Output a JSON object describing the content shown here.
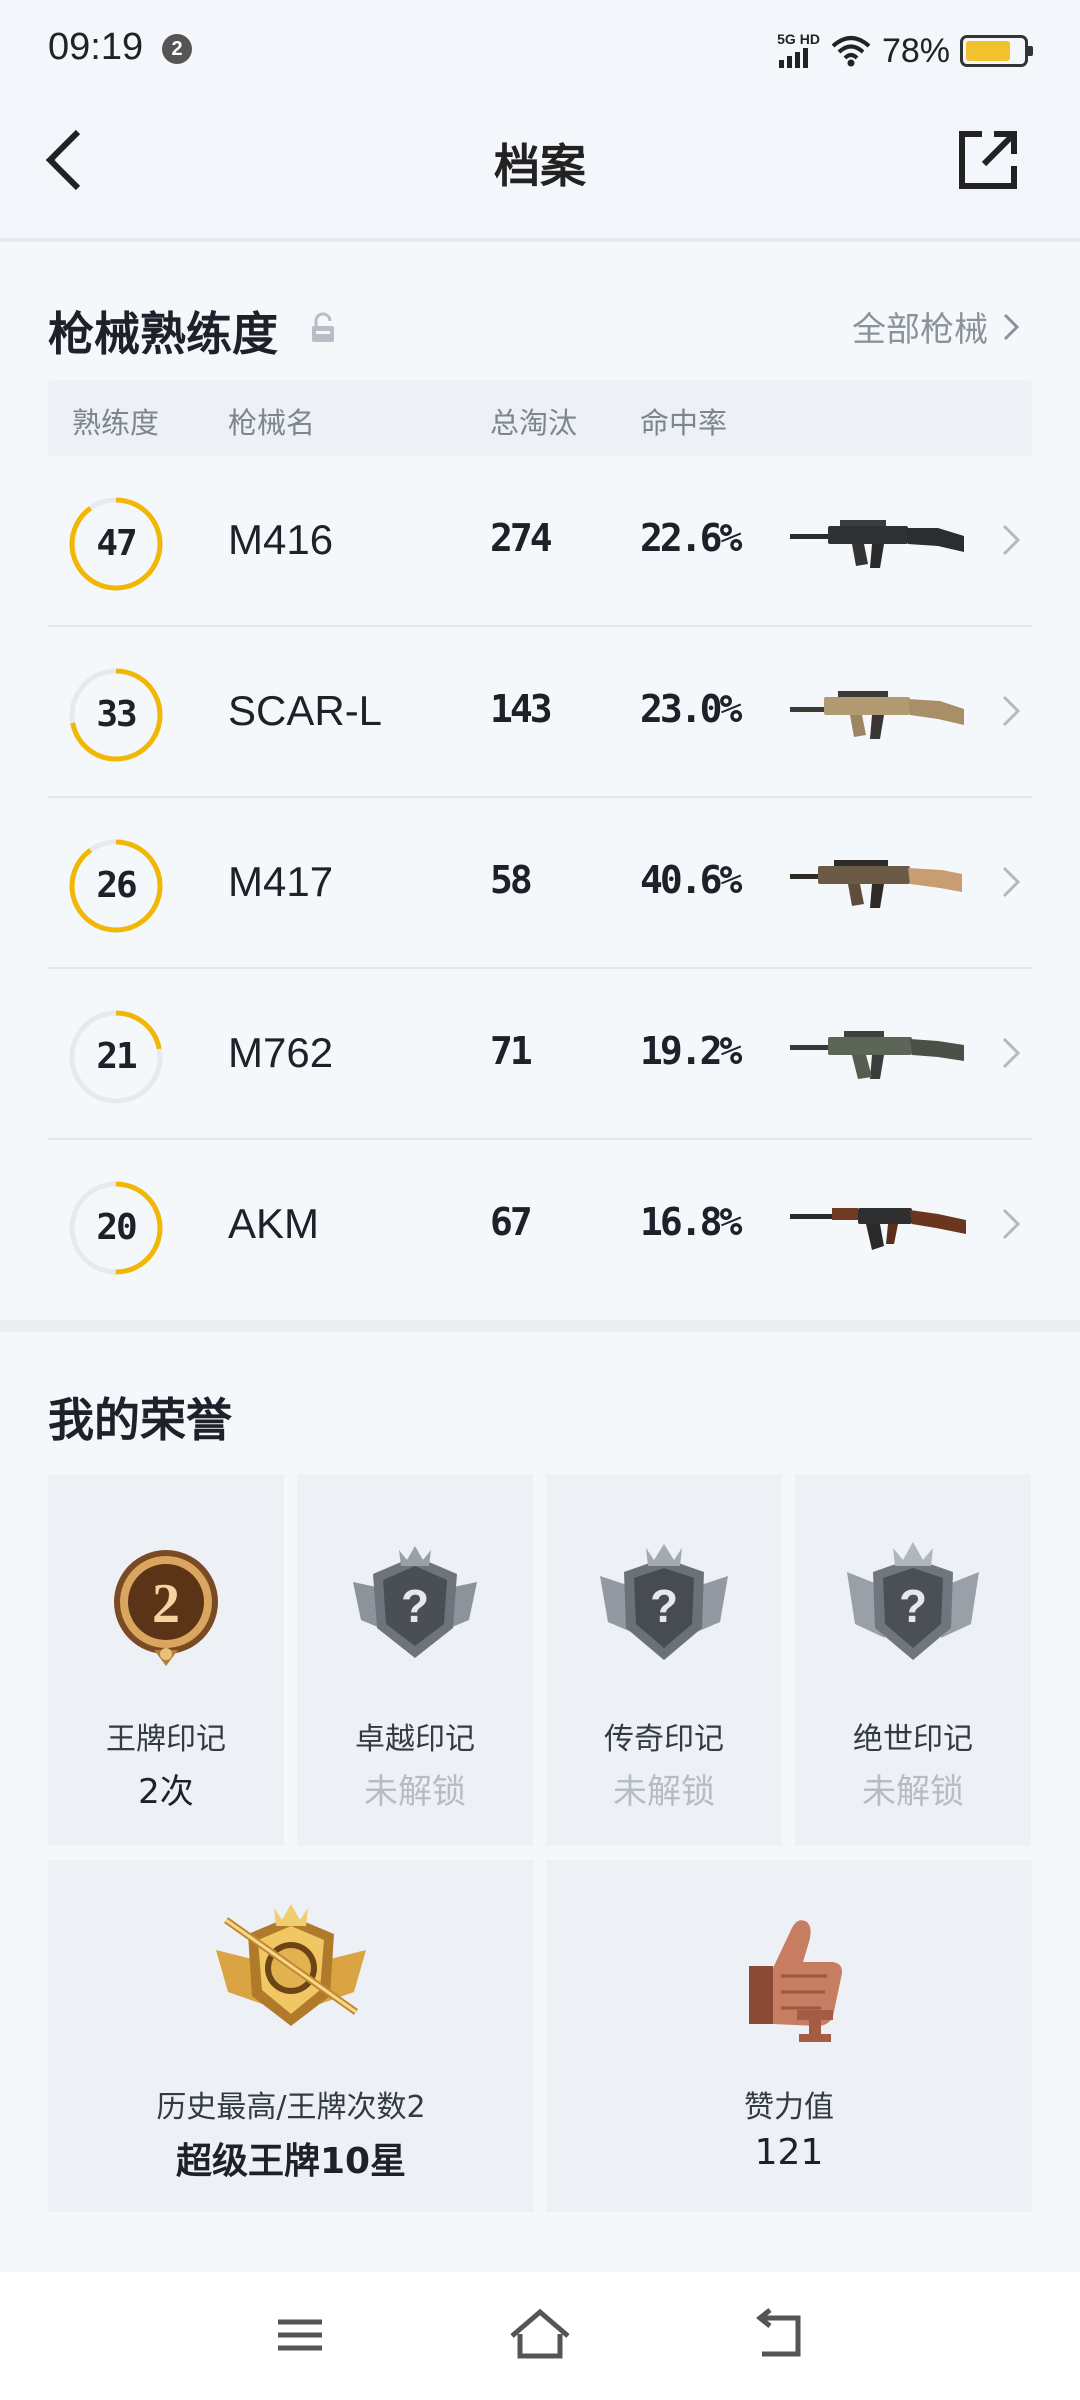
{
  "status_bar": {
    "time": "09:19",
    "notification_count": "2",
    "network": "5G HD",
    "battery": "78%",
    "battery_level": 0.78
  },
  "header": {
    "title": "档案",
    "back_icon": "chevron-left-icon",
    "share_icon": "external-link-icon"
  },
  "weapons": {
    "title": "枪械熟练度",
    "all_label": "全部枪械",
    "columns": [
      "熟练度",
      "枪械名",
      "总淘汰",
      "命中率"
    ],
    "rows": [
      {
        "level": "47",
        "name": "M416",
        "kills": "274",
        "accuracy": "22.6%",
        "progress": 0.9
      },
      {
        "level": "33",
        "name": "SCAR-L",
        "kills": "143",
        "accuracy": "23.0%",
        "progress": 0.72
      },
      {
        "level": "26",
        "name": "M417",
        "kills": "58",
        "accuracy": "40.6%",
        "progress": 0.9
      },
      {
        "level": "21",
        "name": "M762",
        "kills": "71",
        "accuracy": "19.2%",
        "progress": 0.22
      },
      {
        "level": "20",
        "name": "AKM",
        "kills": "67",
        "accuracy": "16.8%",
        "progress": 0.5
      }
    ]
  },
  "honors": {
    "title": "我的荣誉",
    "badges": [
      {
        "label": "王牌印记",
        "value": "2次",
        "emblem_text": "2",
        "locked": false
      },
      {
        "label": "卓越印记",
        "value": "未解锁",
        "emblem_text": "?",
        "locked": true
      },
      {
        "label": "传奇印记",
        "value": "未解锁",
        "emblem_text": "?",
        "locked": true
      },
      {
        "label": "绝世印记",
        "value": "未解锁",
        "emblem_text": "?",
        "locked": true
      }
    ],
    "rank_card": {
      "label": "历史最高/王牌次数2",
      "value": "超级王牌10星"
    },
    "likes_card": {
      "label": "赞力值",
      "value": "121"
    }
  },
  "colors": {
    "accent": "#f2b705",
    "track": "#e6e9ee",
    "muted": "#8a929c"
  }
}
